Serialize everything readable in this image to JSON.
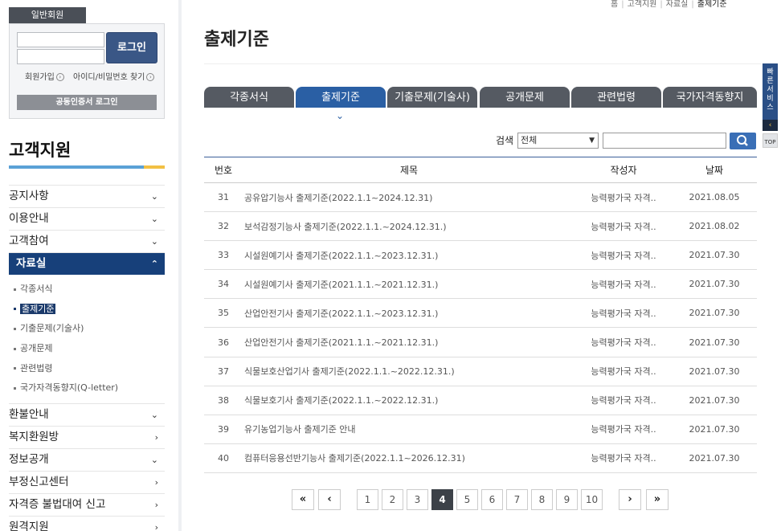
{
  "breadcrumb": [
    "홈",
    "고객지원",
    "자료실",
    "출제기준"
  ],
  "login": {
    "tab": "일반회원",
    "button": "로그인",
    "join": "회원가입",
    "find": "아이디/비밀번호 찾기",
    "cert": "공동인증서 로그인"
  },
  "sidebar": {
    "title": "고객지원",
    "menu": [
      {
        "label": "공지사항",
        "chev": "⌄"
      },
      {
        "label": "이용안내",
        "chev": "⌄"
      },
      {
        "label": "고객참여",
        "chev": "⌄"
      },
      {
        "label": "자료실",
        "chev": "⌃"
      }
    ],
    "submenu": [
      "각종서식",
      "출제기준",
      "기출문제(기술사)",
      "공개문제",
      "관련법령",
      "국가자격동향지(Q-letter)"
    ],
    "menu_after": [
      {
        "label": "환불안내",
        "chev": "⌄"
      },
      {
        "label": "복지환원방",
        "chev": "›"
      },
      {
        "label": "정보공개",
        "chev": "⌄"
      },
      {
        "label": "부정신고센터",
        "chev": "›"
      },
      {
        "label": "자격증 불법대여 신고",
        "chev": "›"
      },
      {
        "label": "원격지원",
        "chev": "›"
      }
    ]
  },
  "page_title": "출제기준",
  "tabs": [
    "각종서식",
    "출제기준",
    "기출문제(기술사)",
    "공개문제",
    "관련법령",
    "국가자격동향지"
  ],
  "search": {
    "label": "검색",
    "select": "전체"
  },
  "table": {
    "headers": [
      "번호",
      "제목",
      "작성자",
      "날짜"
    ],
    "rows": [
      {
        "num": "31",
        "title": "공유압기능사 출제기준(2022.1.1~2024.12.31)",
        "author": "능력평가국 자격..",
        "date": "2021.08.05"
      },
      {
        "num": "32",
        "title": "보석감정기능사 출제기준(2022.1.1.~2024.12.31.)",
        "author": "능력평가국 자격..",
        "date": "2021.08.02"
      },
      {
        "num": "33",
        "title": "시설원예기사 출제기준(2022.1.1.~2023.12.31.)",
        "author": "능력평가국 자격..",
        "date": "2021.07.30"
      },
      {
        "num": "34",
        "title": "시설원예기사 출제기준(2021.1.1.~2021.12.31.)",
        "author": "능력평가국 자격..",
        "date": "2021.07.30"
      },
      {
        "num": "35",
        "title": "산업안전기사 출제기준(2022.1.1.~2023.12.31.)",
        "author": "능력평가국 자격..",
        "date": "2021.07.30"
      },
      {
        "num": "36",
        "title": "산업안전기사 출제기준(2021.1.1.~2021.12.31.)",
        "author": "능력평가국 자격..",
        "date": "2021.07.30"
      },
      {
        "num": "37",
        "title": "식물보호산업기사 출제기준(2022.1.1.~2022.12.31.)",
        "author": "능력평가국 자격..",
        "date": "2021.07.30"
      },
      {
        "num": "38",
        "title": "식물보호기사 출제기준(2022.1.1.~2022.12.31.)",
        "author": "능력평가국 자격..",
        "date": "2021.07.30"
      },
      {
        "num": "39",
        "title": "유기농업기능사 출제기준 안내",
        "author": "능력평가국 자격..",
        "date": "2021.07.30"
      },
      {
        "num": "40",
        "title": "컴퓨터응용선반기능사 출제기준(2022.1.1~2026.12.31)",
        "author": "능력평가국 자격..",
        "date": "2021.07.30"
      }
    ]
  },
  "pagination": {
    "first": "«",
    "prev": "‹",
    "next": "›",
    "last": "»",
    "pages": [
      "1",
      "2",
      "3",
      "4",
      "5",
      "6",
      "7",
      "8",
      "9",
      "10"
    ],
    "current": "4"
  },
  "quick": {
    "label": "빠른서비스",
    "toggle": "‹",
    "top": "TOP"
  }
}
